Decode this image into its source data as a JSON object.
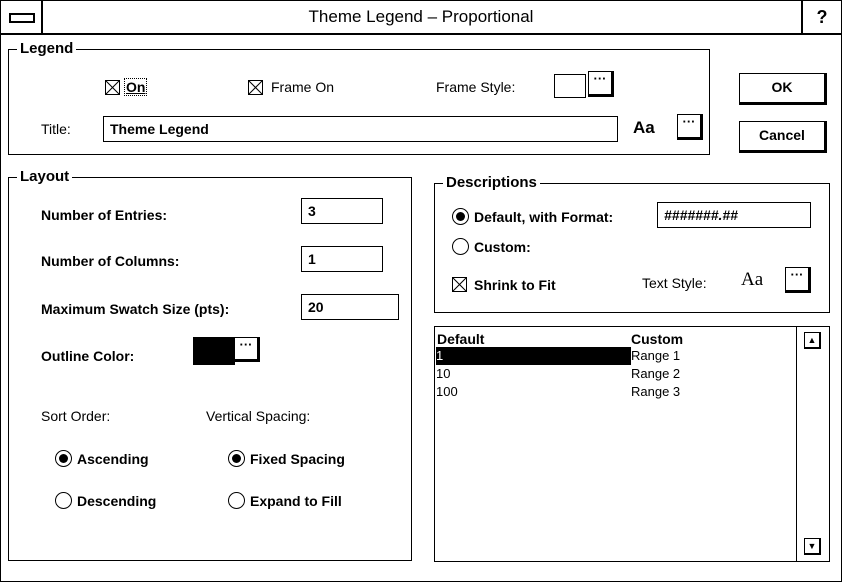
{
  "title_bar": {
    "title": "Theme Legend – Proportional",
    "help_label": "?"
  },
  "legend_group": {
    "label": "Legend",
    "on_label": "On",
    "frame_on_label": "Frame On",
    "frame_style_label": "Frame Style:",
    "title_label": "Title:",
    "title_value": "Theme Legend",
    "aa_label": "Aa",
    "ellipsis": "···"
  },
  "buttons": {
    "ok": "OK",
    "cancel": "Cancel"
  },
  "layout_group": {
    "label": "Layout",
    "num_entries_label": "Number of Entries:",
    "num_entries_value": "3",
    "num_columns_label": "Number of Columns:",
    "num_columns_value": "1",
    "max_swatch_label": "Maximum Swatch Size (pts):",
    "max_swatch_value": "20",
    "outline_color_label": "Outline Color:",
    "outline_color": "#000000",
    "sort_order_label": "Sort Order:",
    "vertical_spacing_label": "Vertical Spacing:",
    "ascending_label": "Ascending",
    "descending_label": "Descending",
    "fixed_spacing_label": "Fixed Spacing",
    "expand_fill_label": "Expand to Fill"
  },
  "descriptions_group": {
    "label": "Descriptions",
    "default_format_label": "Default, with Format:",
    "format_value": "#######.##",
    "custom_label": "Custom:",
    "shrink_label": "Shrink to Fit",
    "text_style_label": "Text Style:",
    "aa_label": "Aa"
  },
  "list": {
    "headers": [
      "Default",
      "Custom"
    ],
    "rows": [
      {
        "default": "1",
        "custom": "Range 1",
        "selected": true
      },
      {
        "default": "10",
        "custom": "Range 2",
        "selected": false
      },
      {
        "default": "100",
        "custom": "Range 3",
        "selected": false
      }
    ],
    "scroll_up": "▲",
    "scroll_down": "▼"
  }
}
